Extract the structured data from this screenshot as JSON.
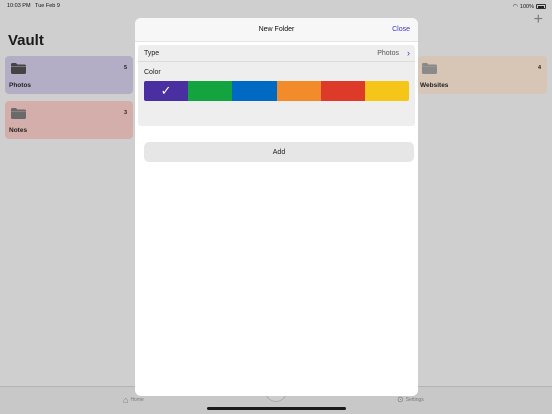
{
  "status_bar": {
    "time": "10:03 PM",
    "date": "Tue Feb 9",
    "battery": "100%"
  },
  "vault": {
    "title": "Vault",
    "tiles": [
      {
        "label": "Photos",
        "count": "5",
        "color": "#b3aec6"
      },
      {
        "label": "Notes",
        "count": "3",
        "color": "#d3aeab"
      },
      {
        "label": "Websites",
        "count": "4",
        "color": "#d7c6b6"
      }
    ]
  },
  "tabbar": {
    "home_label": "Home",
    "settings_label": "Settings"
  },
  "modal": {
    "title": "New Folder",
    "close_label": "Close",
    "type_label": "Type",
    "type_value": "Photos",
    "color_label": "Color",
    "selected_color_index": 0,
    "swatches": [
      "#4a2fa0",
      "#13a440",
      "#0069c2",
      "#f28c2a",
      "#dd3a2a",
      "#f5c518"
    ],
    "add_label": "Add"
  }
}
